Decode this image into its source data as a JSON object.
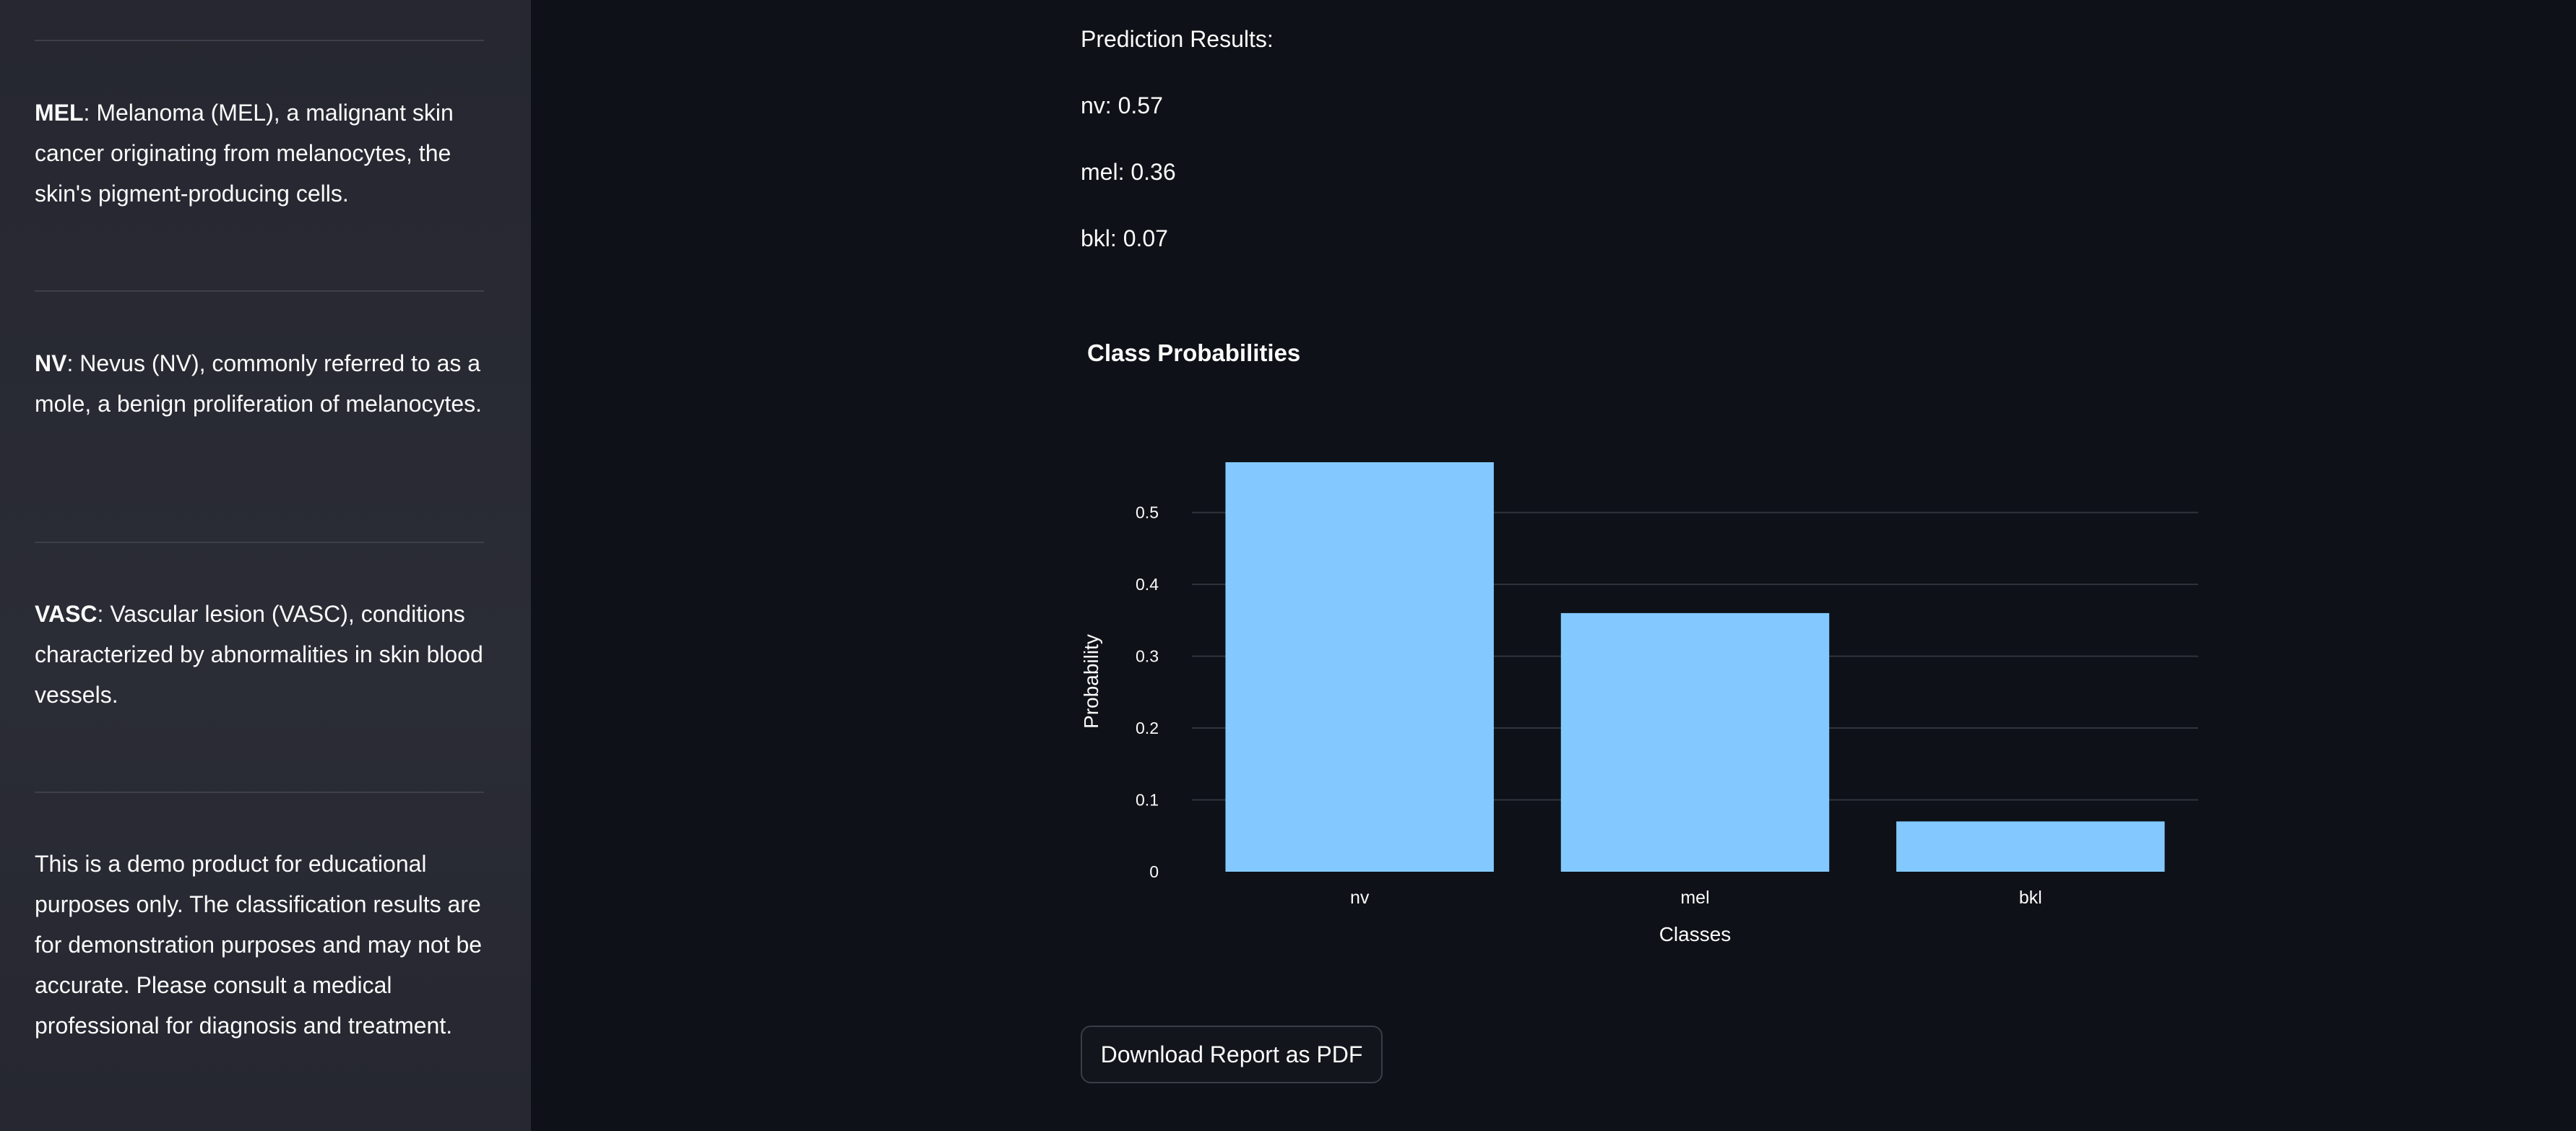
{
  "sidebar": {
    "items": [
      {
        "term": "MEL",
        "text": ": Melanoma (MEL), a malignant skin cancer originating from melanocytes, the skin's pigment-producing cells."
      },
      {
        "term": "NV",
        "text": ": Nevus (NV), commonly referred to as a mole, a benign proliferation of melanocytes."
      },
      {
        "term": "VASC",
        "text": ": Vascular lesion (VASC), conditions characterized by abnormalities in skin blood vessels."
      }
    ],
    "disclaimer": "This is a demo product for educational purposes only. The classification results are for demonstration purposes and may not be accurate. Please consult a medical professional for diagnosis and treatment."
  },
  "main": {
    "results_heading": "Prediction Results:",
    "results": [
      "nv: 0.57",
      "mel: 0.36",
      "bkl: 0.07"
    ],
    "chart_title": "Class Probabilities",
    "download_label": "Download Report as PDF"
  },
  "chart_data": {
    "type": "bar",
    "title": "Class Probabilities",
    "categories": [
      "nv",
      "mel",
      "bkl"
    ],
    "values": [
      0.57,
      0.36,
      0.07
    ],
    "xlabel": "Classes",
    "ylabel": "Probability",
    "ylim": [
      0,
      0.57
    ],
    "yticks": [
      0,
      0.1,
      0.2,
      0.3,
      0.4,
      0.5
    ],
    "ytick_labels": [
      "0",
      "0.1",
      "0.2",
      "0.3",
      "0.4",
      "0.5"
    ],
    "grid": true,
    "bar_color": "#83c9ff",
    "legend": "none"
  }
}
